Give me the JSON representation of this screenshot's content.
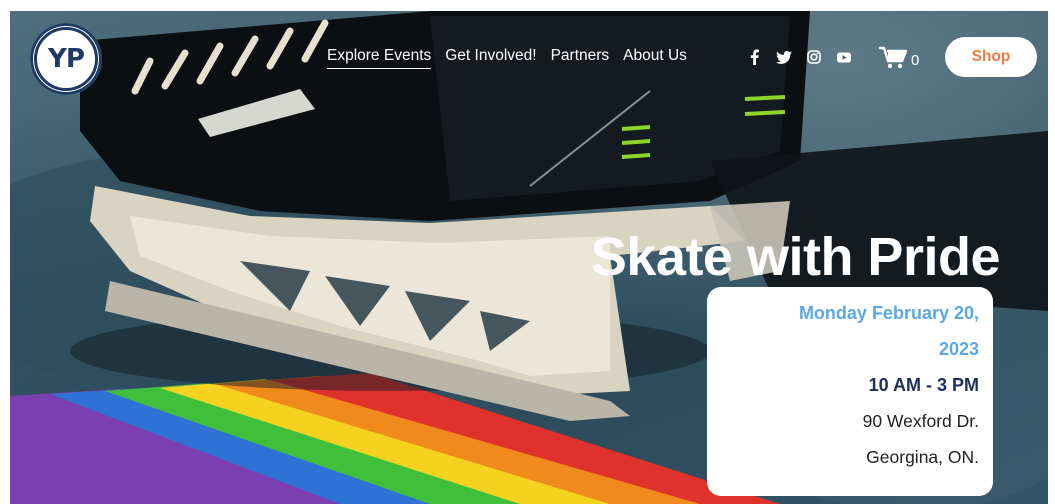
{
  "logo": {
    "text": "YP"
  },
  "nav": {
    "items": [
      {
        "label": "Explore Events",
        "name": "nav-explore-events"
      },
      {
        "label": "Get Involved!",
        "name": "nav-get-involved"
      },
      {
        "label": "Partners",
        "name": "nav-partners"
      },
      {
        "label": "About Us",
        "name": "nav-about-us"
      }
    ]
  },
  "socials": [
    "facebook-icon",
    "twitter-icon",
    "instagram-icon",
    "youtube-icon"
  ],
  "cart": {
    "icon": "cart-icon",
    "count": "0"
  },
  "shop": {
    "label": "Shop"
  },
  "hero": {
    "title": "Skate with Pride",
    "date_line1": "Monday February 20,",
    "date_line2": "2023",
    "time": "10 AM - 3 PM",
    "address_line1": "90 Wexford Dr.",
    "address_line2": "Georgina, ON."
  },
  "colors": {
    "accent_orange": "#f07a45",
    "date_blue": "#5aa8e6",
    "time_navy": "#1c2e5c",
    "logo_navy": "#1f3a63"
  }
}
